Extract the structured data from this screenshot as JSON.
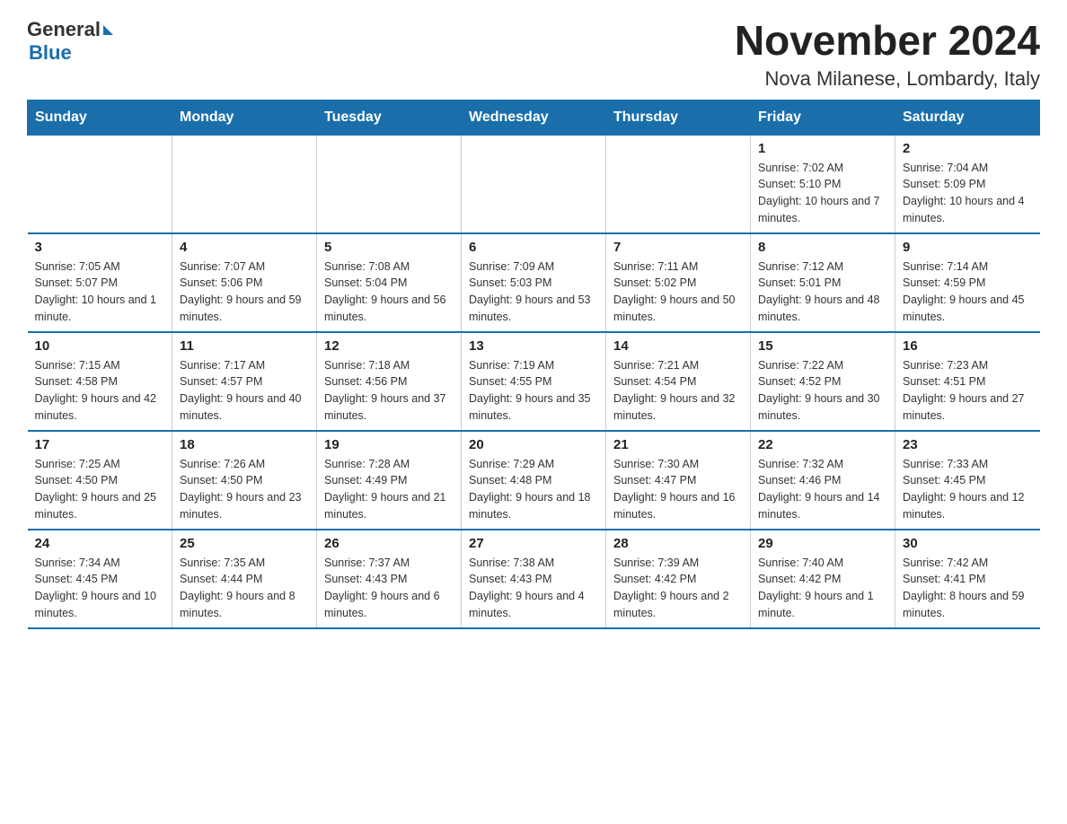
{
  "logo": {
    "text_general": "General",
    "text_blue": "Blue"
  },
  "title": "November 2024",
  "subtitle": "Nova Milanese, Lombardy, Italy",
  "weekdays": [
    "Sunday",
    "Monday",
    "Tuesday",
    "Wednesday",
    "Thursday",
    "Friday",
    "Saturday"
  ],
  "weeks": [
    [
      {
        "day": "",
        "info": ""
      },
      {
        "day": "",
        "info": ""
      },
      {
        "day": "",
        "info": ""
      },
      {
        "day": "",
        "info": ""
      },
      {
        "day": "",
        "info": ""
      },
      {
        "day": "1",
        "info": "Sunrise: 7:02 AM\nSunset: 5:10 PM\nDaylight: 10 hours and 7 minutes."
      },
      {
        "day": "2",
        "info": "Sunrise: 7:04 AM\nSunset: 5:09 PM\nDaylight: 10 hours and 4 minutes."
      }
    ],
    [
      {
        "day": "3",
        "info": "Sunrise: 7:05 AM\nSunset: 5:07 PM\nDaylight: 10 hours and 1 minute."
      },
      {
        "day": "4",
        "info": "Sunrise: 7:07 AM\nSunset: 5:06 PM\nDaylight: 9 hours and 59 minutes."
      },
      {
        "day": "5",
        "info": "Sunrise: 7:08 AM\nSunset: 5:04 PM\nDaylight: 9 hours and 56 minutes."
      },
      {
        "day": "6",
        "info": "Sunrise: 7:09 AM\nSunset: 5:03 PM\nDaylight: 9 hours and 53 minutes."
      },
      {
        "day": "7",
        "info": "Sunrise: 7:11 AM\nSunset: 5:02 PM\nDaylight: 9 hours and 50 minutes."
      },
      {
        "day": "8",
        "info": "Sunrise: 7:12 AM\nSunset: 5:01 PM\nDaylight: 9 hours and 48 minutes."
      },
      {
        "day": "9",
        "info": "Sunrise: 7:14 AM\nSunset: 4:59 PM\nDaylight: 9 hours and 45 minutes."
      }
    ],
    [
      {
        "day": "10",
        "info": "Sunrise: 7:15 AM\nSunset: 4:58 PM\nDaylight: 9 hours and 42 minutes."
      },
      {
        "day": "11",
        "info": "Sunrise: 7:17 AM\nSunset: 4:57 PM\nDaylight: 9 hours and 40 minutes."
      },
      {
        "day": "12",
        "info": "Sunrise: 7:18 AM\nSunset: 4:56 PM\nDaylight: 9 hours and 37 minutes."
      },
      {
        "day": "13",
        "info": "Sunrise: 7:19 AM\nSunset: 4:55 PM\nDaylight: 9 hours and 35 minutes."
      },
      {
        "day": "14",
        "info": "Sunrise: 7:21 AM\nSunset: 4:54 PM\nDaylight: 9 hours and 32 minutes."
      },
      {
        "day": "15",
        "info": "Sunrise: 7:22 AM\nSunset: 4:52 PM\nDaylight: 9 hours and 30 minutes."
      },
      {
        "day": "16",
        "info": "Sunrise: 7:23 AM\nSunset: 4:51 PM\nDaylight: 9 hours and 27 minutes."
      }
    ],
    [
      {
        "day": "17",
        "info": "Sunrise: 7:25 AM\nSunset: 4:50 PM\nDaylight: 9 hours and 25 minutes."
      },
      {
        "day": "18",
        "info": "Sunrise: 7:26 AM\nSunset: 4:50 PM\nDaylight: 9 hours and 23 minutes."
      },
      {
        "day": "19",
        "info": "Sunrise: 7:28 AM\nSunset: 4:49 PM\nDaylight: 9 hours and 21 minutes."
      },
      {
        "day": "20",
        "info": "Sunrise: 7:29 AM\nSunset: 4:48 PM\nDaylight: 9 hours and 18 minutes."
      },
      {
        "day": "21",
        "info": "Sunrise: 7:30 AM\nSunset: 4:47 PM\nDaylight: 9 hours and 16 minutes."
      },
      {
        "day": "22",
        "info": "Sunrise: 7:32 AM\nSunset: 4:46 PM\nDaylight: 9 hours and 14 minutes."
      },
      {
        "day": "23",
        "info": "Sunrise: 7:33 AM\nSunset: 4:45 PM\nDaylight: 9 hours and 12 minutes."
      }
    ],
    [
      {
        "day": "24",
        "info": "Sunrise: 7:34 AM\nSunset: 4:45 PM\nDaylight: 9 hours and 10 minutes."
      },
      {
        "day": "25",
        "info": "Sunrise: 7:35 AM\nSunset: 4:44 PM\nDaylight: 9 hours and 8 minutes."
      },
      {
        "day": "26",
        "info": "Sunrise: 7:37 AM\nSunset: 4:43 PM\nDaylight: 9 hours and 6 minutes."
      },
      {
        "day": "27",
        "info": "Sunrise: 7:38 AM\nSunset: 4:43 PM\nDaylight: 9 hours and 4 minutes."
      },
      {
        "day": "28",
        "info": "Sunrise: 7:39 AM\nSunset: 4:42 PM\nDaylight: 9 hours and 2 minutes."
      },
      {
        "day": "29",
        "info": "Sunrise: 7:40 AM\nSunset: 4:42 PM\nDaylight: 9 hours and 1 minute."
      },
      {
        "day": "30",
        "info": "Sunrise: 7:42 AM\nSunset: 4:41 PM\nDaylight: 8 hours and 59 minutes."
      }
    ]
  ]
}
